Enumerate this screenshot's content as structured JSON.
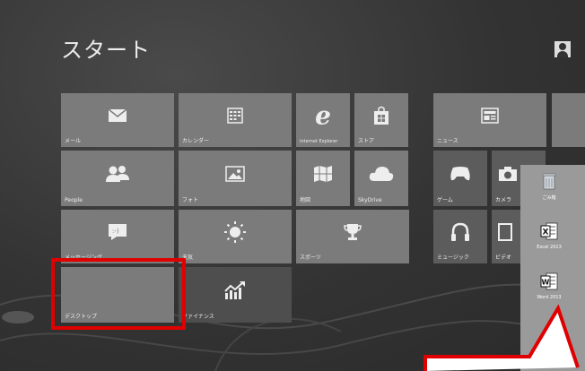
{
  "screen": {
    "title": "スタート"
  },
  "tiles": [
    {
      "name": "mail",
      "label": "メール",
      "icon": "mail-icon"
    },
    {
      "name": "calendar",
      "label": "カレンダー",
      "icon": "calendar-icon"
    },
    {
      "name": "internet-explorer",
      "label": "Internet Explorer",
      "icon": "ie-icon"
    },
    {
      "name": "store",
      "label": "ストア",
      "icon": "store-icon"
    },
    {
      "name": "news",
      "label": "ニュース",
      "icon": "news-icon"
    },
    {
      "name": "people",
      "label": "People",
      "icon": "people-icon"
    },
    {
      "name": "photos",
      "label": "フォト",
      "icon": "photo-icon"
    },
    {
      "name": "maps",
      "label": "地図",
      "icon": "map-icon"
    },
    {
      "name": "skydrive",
      "label": "SkyDrive",
      "icon": "cloud-icon"
    },
    {
      "name": "games",
      "label": "ゲーム",
      "icon": "gamepad-icon"
    },
    {
      "name": "camera",
      "label": "カメラ",
      "icon": "camera-icon"
    },
    {
      "name": "messaging",
      "label": "メッセージング",
      "icon": "chat-icon"
    },
    {
      "name": "weather",
      "label": "天気",
      "icon": "sun-icon"
    },
    {
      "name": "sports",
      "label": "スポーツ",
      "icon": "trophy-icon"
    },
    {
      "name": "music",
      "label": "ミュージック",
      "icon": "headphones-icon"
    },
    {
      "name": "video",
      "label": "ビデオ",
      "icon": "video-icon"
    },
    {
      "name": "desktop",
      "label": "デスクトップ",
      "icon": ""
    },
    {
      "name": "finance",
      "label": "ファイナンス",
      "icon": "chart-icon"
    }
  ],
  "desktop_icons": [
    {
      "name": "recycle-bin",
      "label": "ごみ箱",
      "icon": "recycle-bin-icon"
    },
    {
      "name": "excel-2013",
      "label": "Excel 2013",
      "icon": "excel-icon"
    },
    {
      "name": "word-2013",
      "label": "Word 2013",
      "icon": "word-icon"
    }
  ],
  "colors": {
    "highlight": "#e00000",
    "tile": "#7b7b7b",
    "tile_dark": "#5c5c5c",
    "background": "#333333"
  }
}
